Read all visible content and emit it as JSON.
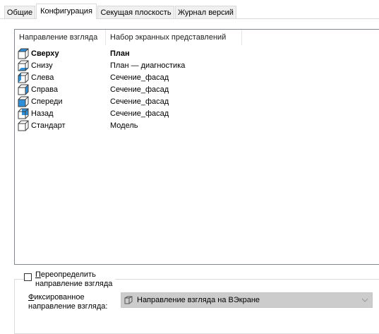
{
  "tabs": [
    {
      "label": "Общие",
      "active": false
    },
    {
      "label": "Конфигурация",
      "active": true
    },
    {
      "label": "Секущая плоскость",
      "active": false
    },
    {
      "label": "Журнал версий",
      "active": false
    }
  ],
  "table": {
    "columns": [
      "Направление взгляда",
      "Набор экранных представлений"
    ],
    "rows": [
      {
        "direction": "Сверху",
        "set": "План",
        "icon": "view-top-icon",
        "bold": true
      },
      {
        "direction": "Снизу",
        "set": "План — диагностика",
        "icon": "view-bottom-icon",
        "bold": false
      },
      {
        "direction": "Слева",
        "set": "Сечение_фасад",
        "icon": "view-left-icon",
        "bold": false
      },
      {
        "direction": "Справа",
        "set": "Сечение_фасад",
        "icon": "view-right-icon",
        "bold": false
      },
      {
        "direction": "Спереди",
        "set": "Сечение_фасад",
        "icon": "view-front-icon",
        "bold": false
      },
      {
        "direction": "Назад",
        "set": "Сечение_фасад",
        "icon": "view-back-icon",
        "bold": false
      },
      {
        "direction": "Стандарт",
        "set": "Модель",
        "icon": "view-default-icon",
        "bold": false
      }
    ]
  },
  "override": {
    "label_line1_underlined": "П",
    "label_line1_rest": "ереопределить",
    "label_line2": "направление взгляда",
    "checked": false
  },
  "fixed": {
    "label_line1_underlined": "Ф",
    "label_line1_rest": "иксированное",
    "label_line2": "направление взгляда:",
    "value": "Направление взгляда на ВЭкране",
    "value_icon": "cube-view-icon",
    "disabled": true
  },
  "colors": {
    "accent": "#2f8fd8",
    "border": "#828790",
    "disabled_field": "#cccccc"
  }
}
